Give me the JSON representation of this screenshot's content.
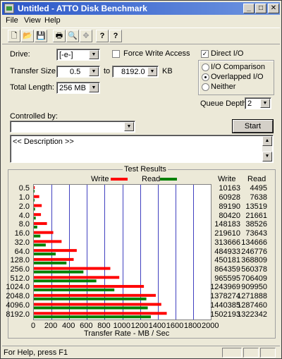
{
  "window": {
    "title": "Untitled - ATTO Disk Benchmark",
    "minimize_glyph": "_",
    "maximize_glyph": "□",
    "close_glyph": "✕"
  },
  "menu": {
    "file": "File",
    "view": "View",
    "help": "Help"
  },
  "toolbar": {
    "new": "🗋",
    "open": "📂",
    "save": "💾",
    "print": "🖶",
    "preview": "🔍",
    "move": "✥",
    "help": "?",
    "context_help": "?"
  },
  "form": {
    "drive_label": "Drive:",
    "drive_value": "[-e-]",
    "force_write_access_label": "Force Write Access",
    "force_write_access_checked": false,
    "direct_io_label": "Direct I/O",
    "direct_io_checked": true,
    "transfer_size_label": "Transfer Size:",
    "transfer_size_from": "0.5",
    "transfer_size_to_label": "to",
    "transfer_size_to": "8192.0",
    "transfer_size_unit": "KB",
    "total_length_label": "Total Length:",
    "total_length_value": "256 MB",
    "io_comparison_label": "I/O Comparison",
    "overlapped_io_label": "Overlapped I/O",
    "neither_label": "Neither",
    "selected_io_mode": "overlapped",
    "queue_depth_label": "Queue Depth:",
    "queue_depth_value": "2",
    "controlled_by_label": "Controlled by:",
    "controlled_by_value": "",
    "start_button": "Start",
    "description": "<< Description >>"
  },
  "chart_data": {
    "type": "bar",
    "orientation": "horizontal",
    "title": "Test Results",
    "xlabel": "Transfer Rate - MB / Sec",
    "xlim": [
      0,
      2000
    ],
    "xticks": [
      0,
      200,
      400,
      600,
      800,
      1000,
      1200,
      1400,
      1600,
      1800,
      2000
    ],
    "grid": true,
    "categories": [
      "0.5",
      "1.0",
      "2.0",
      "4.0",
      "8.0",
      "16.0",
      "32.0",
      "64.0",
      "128.0",
      "256.0",
      "512.0",
      "1024.0",
      "2048.0",
      "4096.0",
      "8192.0"
    ],
    "series": [
      {
        "name": "Write",
        "color": "#ff0000",
        "values": [
          10163,
          60928,
          89190,
          80420,
          148183,
          219610,
          313666,
          484933,
          450181,
          864359,
          965595,
          1243969,
          1378274,
          1440385,
          1502193
        ]
      },
      {
        "name": "Read",
        "color": "#008000",
        "values": [
          4495,
          7638,
          13519,
          21661,
          38526,
          73643,
          134666,
          246776,
          368809,
          560378,
          706409,
          909950,
          1271888,
          1287460,
          1322342
        ]
      }
    ],
    "value_columns": [
      "Write",
      "Read"
    ],
    "value_unit_note": "values in KB/s; bars in MB/s",
    "legend_position": "top"
  },
  "status": {
    "text": "For Help, press F1"
  }
}
